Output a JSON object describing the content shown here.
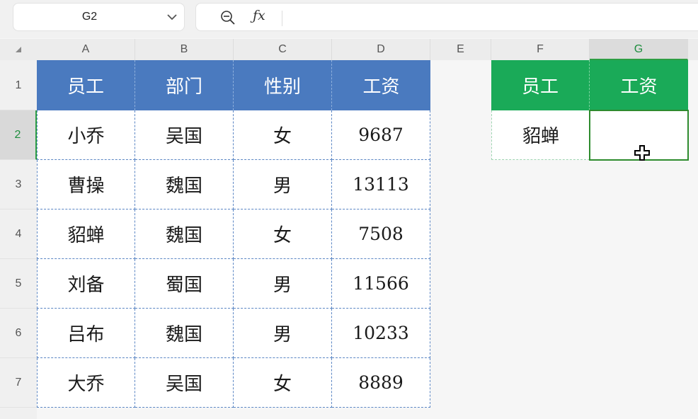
{
  "toolbar": {
    "name_box": "G2",
    "formula_value": "",
    "icons": [
      "zoom-out-icon",
      "fx-icon",
      "chevron-down-icon"
    ]
  },
  "column_headers": [
    "A",
    "B",
    "C",
    "D",
    "E",
    "F",
    "G"
  ],
  "row_headers": [
    "1",
    "2",
    "3",
    "4",
    "5",
    "6",
    "7"
  ],
  "table": {
    "headers": [
      "员工",
      "部门",
      "性别",
      "工资"
    ],
    "rows": [
      [
        "小乔",
        "吴国",
        "女",
        "9687"
      ],
      [
        "曹操",
        "魏国",
        "男",
        "13113"
      ],
      [
        "貂蝉",
        "魏国",
        "女",
        "7508"
      ],
      [
        "刘备",
        "蜀国",
        "男",
        "11566"
      ],
      [
        "吕布",
        "魏国",
        "男",
        "10233"
      ],
      [
        "大乔",
        "吴国",
        "女",
        "8889"
      ]
    ]
  },
  "lookup": {
    "headers": [
      "员工",
      "工资"
    ],
    "employee": "貂蝉",
    "salary": ""
  },
  "selection": {
    "cell": "G2",
    "column": "G",
    "row": "2"
  },
  "colors": {
    "table_header": "#4a7abf",
    "lookup_header": "#1aaa58",
    "selection": "#2e8b2e"
  }
}
